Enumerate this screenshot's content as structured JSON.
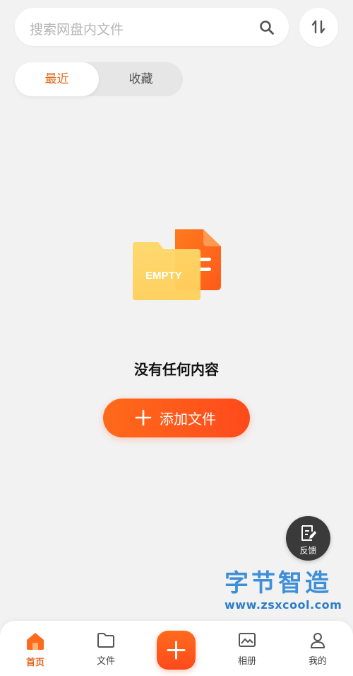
{
  "search": {
    "placeholder": "搜索网盘内文件",
    "icon": "search-icon"
  },
  "sort": {
    "icon": "sort-icon"
  },
  "tabs": [
    {
      "label": "最近",
      "active": true
    },
    {
      "label": "收藏",
      "active": false
    }
  ],
  "empty": {
    "illustration_label": "EMPTY",
    "message": "没有任何内容"
  },
  "add_button": {
    "label": "添加文件",
    "icon": "plus-icon"
  },
  "feedback": {
    "label": "反馈",
    "icon": "edit-note-icon"
  },
  "watermark": {
    "title": "字节智造",
    "url": "www.zsxcool.com"
  },
  "bottom_nav": {
    "items": [
      {
        "label": "首页",
        "icon": "home-icon",
        "active": true
      },
      {
        "label": "文件",
        "icon": "folder-icon",
        "active": false
      },
      {
        "label": "",
        "icon": "plus-icon",
        "active": false
      },
      {
        "label": "相册",
        "icon": "photo-icon",
        "active": false
      },
      {
        "label": "我的",
        "icon": "user-icon",
        "active": false
      }
    ]
  },
  "colors": {
    "accent": "#ff5a1c",
    "active_text": "#e06a1a",
    "background": "#f2f2f2"
  }
}
